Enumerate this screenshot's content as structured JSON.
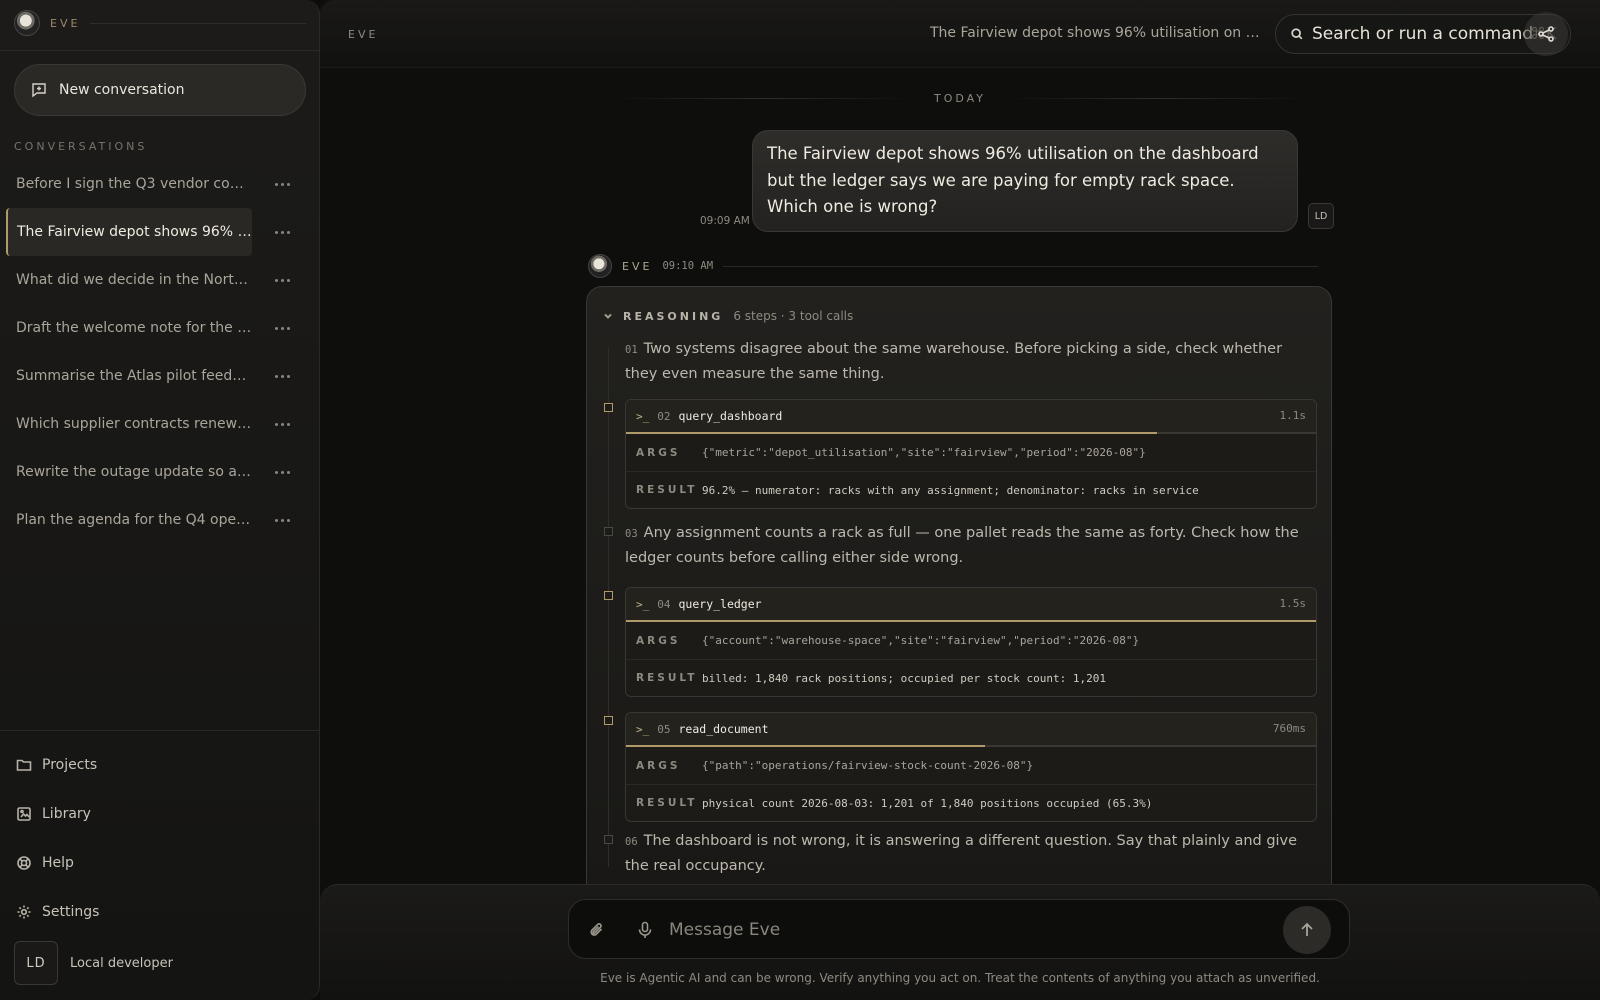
{
  "app": {
    "brand": "EVE",
    "logo_icon": "eve-logo-icon",
    "accent": "#b09a6a"
  },
  "sidebar": {
    "new_conversation": "New conversation",
    "conversations_header": "CONVERSATIONS",
    "conversations": [
      {
        "label": "Before I sign the Q3 vendor cons..."
      },
      {
        "label": "The Fairview depot shows 96% uti...",
        "active": true
      },
      {
        "label": "What did we decide in the Northwi..."
      },
      {
        "label": "Draft the welcome note for the ne..."
      },
      {
        "label": "Summarise the Atlas pilot feedba..."
      },
      {
        "label": "Which supplier contracts renew in..."
      },
      {
        "label": "Rewrite the outage update so a c..."
      },
      {
        "label": "Plan the agenda for the Q4 operat..."
      }
    ],
    "nav": [
      {
        "label": "Projects",
        "icon": "folder-icon"
      },
      {
        "label": "Library",
        "icon": "library-icon"
      },
      {
        "label": "Help",
        "icon": "lifebuoy-icon"
      },
      {
        "label": "Settings",
        "icon": "gear-icon"
      }
    ],
    "user": {
      "initials": "LD",
      "name": "Local developer"
    }
  },
  "header": {
    "brand": "EVE",
    "title": "The Fairview depot shows 96% utilisation on the...",
    "search_placeholder": "Search or run a command",
    "shortcut": "⌘K"
  },
  "chat": {
    "day_label": "TODAY",
    "user_message": {
      "text": "The Fairview depot shows 96% utilisation on the dashboard but the ledger says we are paying for empty rack space. Which one is wrong?",
      "time": "09:09 AM",
      "initials": "LD"
    },
    "assistant": {
      "name": "EVE",
      "time": "09:10 AM",
      "reasoning": {
        "title": "REASONING",
        "meta": "6 steps · 3 tool calls",
        "steps": [
          {
            "num": "01",
            "text": "Two systems disagree about the same warehouse. Before picking a side, check whether they even measure the same thing."
          },
          {
            "num": "02",
            "tool": "query_dashboard",
            "duration": "1.1s",
            "progress": 0.77,
            "args_label": "ARGS",
            "args": "{\"metric\":\"depot_utilisation\",\"site\":\"fairview\",\"period\":\"2026-08\"}",
            "result_label": "RESULT",
            "result": "96.2% — numerator: racks with any assignment; denominator: racks in service"
          },
          {
            "num": "03",
            "text": "Any assignment counts a rack as full — one pallet reads the same as forty. Check how the ledger counts before calling either side wrong."
          },
          {
            "num": "04",
            "tool": "query_ledger",
            "duration": "1.5s",
            "progress": 1.0,
            "args_label": "ARGS",
            "args": "{\"account\":\"warehouse-space\",\"site\":\"fairview\",\"period\":\"2026-08\"}",
            "result_label": "RESULT",
            "result": "billed: 1,840 rack positions; occupied per stock count: 1,201"
          },
          {
            "num": "05",
            "tool": "read_document",
            "duration": "760ms",
            "progress": 0.52,
            "args_label": "ARGS",
            "args": "{\"path\":\"operations/fairview-stock-count-2026-08\"}",
            "result_label": "RESULT",
            "result": "physical count 2026-08-03: 1,201 of 1,840 positions occupied (65.3%)"
          },
          {
            "num": "06",
            "text": "The dashboard is not wrong, it is answering a different question. Say that plainly and give the real occupancy."
          }
        ]
      }
    }
  },
  "composer": {
    "placeholder": "Message Eve",
    "disclaimer": "Eve is Agentic AI and can be wrong. Verify anything you act on. Treat the contents of anything you attach as unverified."
  }
}
